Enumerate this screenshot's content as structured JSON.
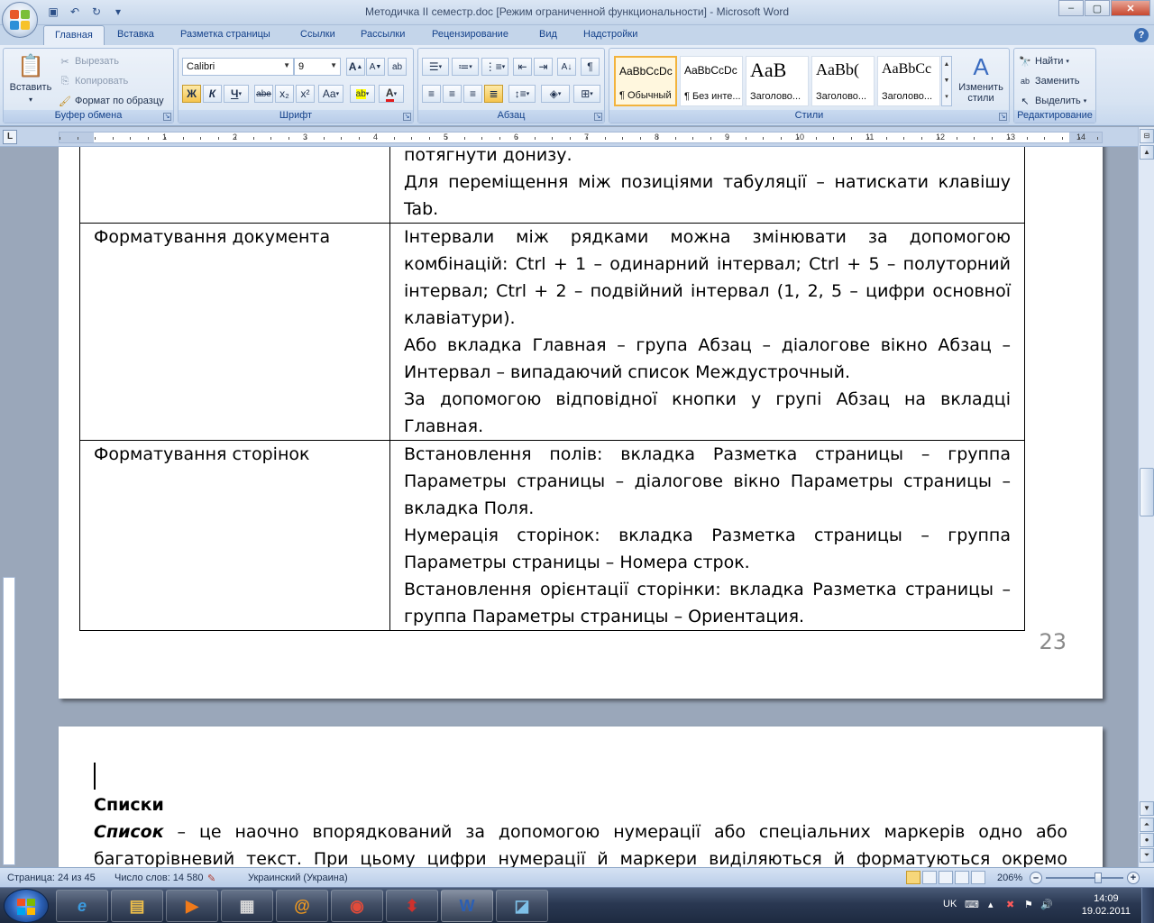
{
  "window": {
    "title": "Методичка ІІ семестр.doc [Режим ограниченной функциональности] - Microsoft Word"
  },
  "tabs": [
    "Главная",
    "Вставка",
    "Разметка страницы",
    "Ссылки",
    "Рассылки",
    "Рецензирование",
    "Вид",
    "Надстройки"
  ],
  "ribbon": {
    "clipboard": {
      "label": "Буфер обмена",
      "paste": "Вставить",
      "cut": "Вырезать",
      "copy": "Копировать",
      "format_painter": "Формат по образцу"
    },
    "font": {
      "label": "Шрифт",
      "font_name": "Calibri",
      "font_size": "9",
      "bold": "Ж",
      "italic": "К",
      "underline": "Ч",
      "strike": "abe",
      "subscript": "x₂",
      "superscript": "x²",
      "case": "Aa",
      "grow": "A",
      "shrink": "A",
      "clear": "ab",
      "highlight": "ab",
      "font_color": "A"
    },
    "paragraph": {
      "label": "Абзац",
      "pilcrow": "¶"
    },
    "styles": {
      "label": "Стили",
      "items": [
        {
          "preview": "AaBbCcDc",
          "name": "¶ Обычный"
        },
        {
          "preview": "AaBbCcDc",
          "name": "¶ Без инте..."
        },
        {
          "preview": "AaB",
          "name": "Заголово..."
        },
        {
          "preview": "AaBb(",
          "name": "Заголово..."
        },
        {
          "preview": "AaBbCc",
          "name": "Заголово..."
        }
      ],
      "change_styles": "Изменить стили"
    },
    "editing": {
      "label": "Редактирование",
      "find": "Найти",
      "replace": "Заменить",
      "select": "Выделить"
    }
  },
  "ruler": {
    "numbers": [
      "1",
      "2",
      "3",
      "4",
      "5",
      "6",
      "7",
      "8",
      "9",
      "10",
      "11",
      "12",
      "13",
      "14"
    ]
  },
  "document": {
    "row0": {
      "right_partial": "потягнути донизу.",
      "right_text": "Для переміщення між позиціями табуляції – натискати клавішу Tab."
    },
    "row1": {
      "left": "Форматування документа",
      "p1": "Інтервали між рядками можна змінювати за допомогою комбінацій: Ctrl + 1 – одинарний інтервал; Ctrl + 5 – полуторний інтервал; Ctrl + 2 – подвійний інтервал (1, 2, 5 – цифри основної клавіатури).",
      "p2": "Або вкладка Главная – група Абзац – діалогове вікно Абзац – Интервал – випадаючий список Междустрочный.",
      "p3": "За допомогою відповідної кнопки у групі Абзац на вкладці Главная."
    },
    "row2": {
      "left": "Форматування сторінок",
      "p1": "Встановлення полів: вкладка Разметка страницы – группа Параметры страницы – діалогове вікно Параметры страницы – вкладка Поля.",
      "p2": "Нумерація сторінок: вкладка Разметка страницы – группа Параметры страницы – Номера строк.",
      "p3": "Встановлення орієнтації сторінки: вкладка Разметка страницы – группа Параметры страницы – Ориентация."
    },
    "page_number": "23",
    "page2": {
      "heading": "Списки",
      "term": "Список",
      "line1_rest": " – це наочно впорядкований за допомогою нумерації або спеціальних маркерів одно або",
      "line2": "багаторівневий текст. При цьому цифри нумерації й маркери виділяються й форматуються окремо"
    }
  },
  "statusbar": {
    "page": "Страница: 24 из 45",
    "words": "Число слов: 14 580",
    "language": "Украинский (Украина)",
    "zoom": "206%"
  },
  "taskbar": {
    "lang": "UK",
    "time": "14:09",
    "date": "19.02.2011"
  },
  "colors": {
    "ribbon_blue": "#15428b",
    "selected_style": "#f2b33d",
    "spell_check": "#d33"
  }
}
